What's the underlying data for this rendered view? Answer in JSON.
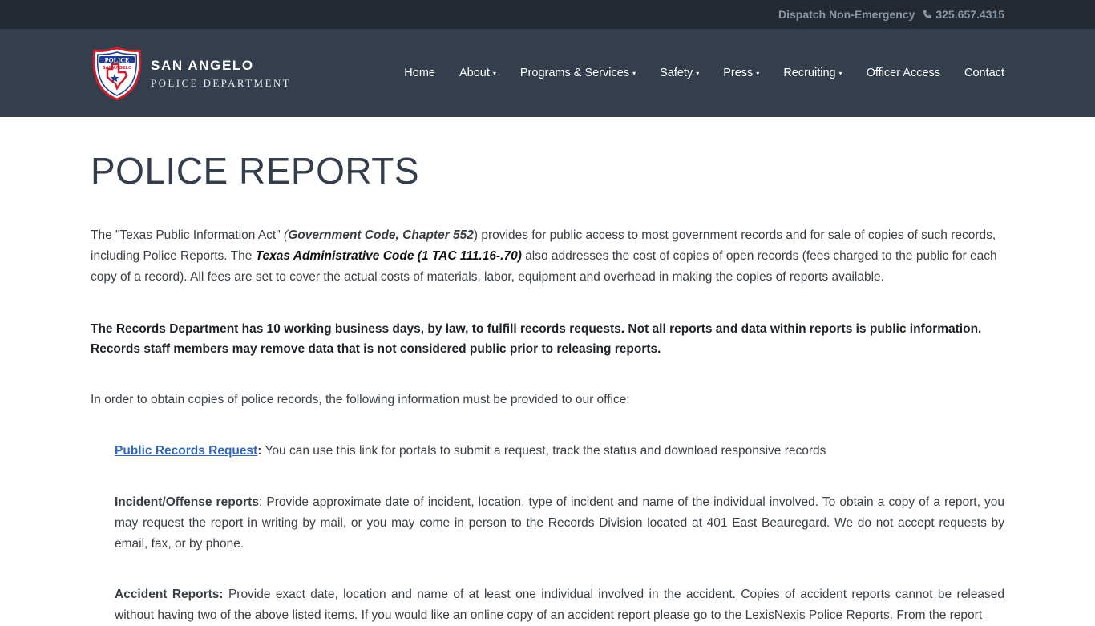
{
  "topbar": {
    "dispatch_label": "Dispatch Non-Emergency",
    "phone_number": "325.657.4315",
    "phone_icon": "phone-icon"
  },
  "brand": {
    "line1": "SAN ANGELO",
    "line2": "POLICE DEPARTMENT",
    "badge_text_top": "POLICE",
    "badge_text_bottom": "SAN ANGELO",
    "colors": {
      "badge_red": "#c8202f",
      "badge_blue": "#1f3c8f"
    }
  },
  "nav": {
    "items": [
      {
        "label": "Home",
        "has_dropdown": false
      },
      {
        "label": "About",
        "has_dropdown": true
      },
      {
        "label": "Programs & Services",
        "has_dropdown": true
      },
      {
        "label": "Safety",
        "has_dropdown": true
      },
      {
        "label": "Press",
        "has_dropdown": true
      },
      {
        "label": "Recruiting",
        "has_dropdown": true
      },
      {
        "label": "Officer Access",
        "has_dropdown": false
      },
      {
        "label": "Contact",
        "has_dropdown": false
      }
    ],
    "caret": "▾"
  },
  "page": {
    "title": "POLICE REPORTS",
    "intro": {
      "part1": "The \"Texas Public Information Act\" ",
      "paren_open": "(",
      "code1": "Government Code, Chapter 552",
      "part2": ") provides for public access to most government records and for sale of copies of such records, including Police Reports.  The ",
      "code2": "Texas Administrative Code (1 TAC 111.16-.70)",
      "part3": " also addresses the cost of copies of open records (fees charged to the public for each copy of a record). All fees are set to cover the actual costs of materials, labor, equipment and overhead in making the copies of reports available."
    },
    "notice": "The Records Department has 10 working business days, by law, to fulfill records requests. Not all reports and data within reports is public information. Records staff members may remove data that is not considered public prior to releasing reports.",
    "obtain": "In order to obtain copies of police records, the following information must be provided to our office:",
    "public_records": {
      "link_label": "Public Records Request",
      "colon": ":",
      "text": "  You can use this link for portals to submit a request, track the status and download responsive records"
    },
    "incident": {
      "label": "Incident/Offense reports",
      "text": ":  Provide approximate date of incident, location, type of incident and name of the individual involved. To obtain a copy of a report, you may request the report in writing by mail, or you may come in person to the Records Division located at 401 East Beauregard.  We do not accept requests by email, fax, or by phone."
    },
    "accident": {
      "label": "Accident Reports:",
      "text": " Provide exact date, location and name of at least one individual involved in the accident. Copies of accident reports cannot be released without having two of the above listed items. If you would like an online copy of an accident report please go to the LexisNexis Police Reports. From the report"
    }
  }
}
